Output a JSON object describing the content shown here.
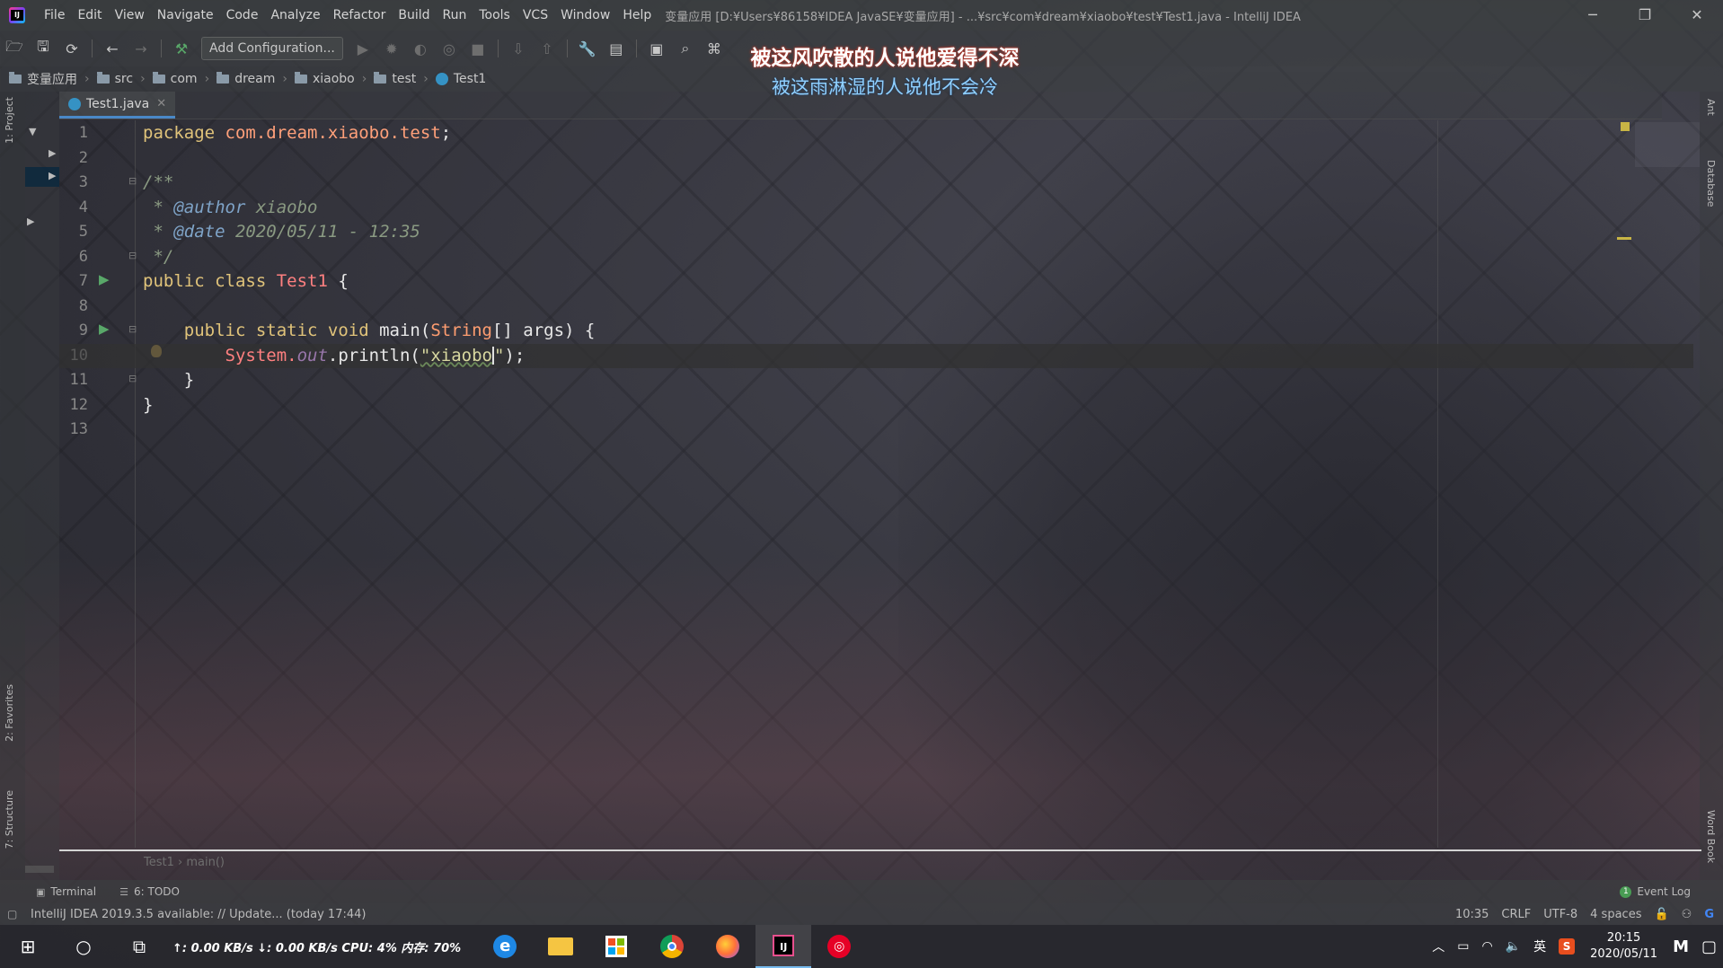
{
  "window": {
    "title": "变量应用 [D:¥Users¥86158¥IDEA JavaSE¥变量应用] - ...¥src¥com¥dream¥xiaobo¥test¥Test1.java - IntelliJ IDEA",
    "controls": {
      "minimize": "─",
      "restore": "❐",
      "close": "✕"
    }
  },
  "menu": [
    "File",
    "Edit",
    "View",
    "Navigate",
    "Code",
    "Analyze",
    "Refactor",
    "Build",
    "Run",
    "Tools",
    "VCS",
    "Window",
    "Help"
  ],
  "toolbar": {
    "add_configuration": "Add Configuration..."
  },
  "breadcrumb": [
    "变量应用",
    "src",
    "com",
    "dream",
    "xiaobo",
    "test",
    "Test1"
  ],
  "lyrics": {
    "line1": "被这风吹散的人说他爱得不深",
    "line2": "被这雨淋湿的人说他不会冷"
  },
  "left_strip": {
    "project": "1: Project",
    "favorites": "2: Favorites",
    "structure": "7: Structure"
  },
  "right_strip": {
    "ant": "Ant",
    "database": "Database",
    "word_book": "Word Book"
  },
  "editor": {
    "tab": "Test1.java",
    "line_numbers": [
      "1",
      "2",
      "3",
      "4",
      "5",
      "6",
      "7",
      "8",
      "9",
      "10",
      "11",
      "12",
      "13"
    ],
    "code": {
      "l1_kw": "package",
      "l1_pkg": "com.dream.xiaobo.test",
      "l1_end": ";",
      "l3": "/**",
      "l4_star": " * ",
      "l4_tag": "@author",
      "l4_val": " xiaobo",
      "l5_star": " * ",
      "l5_tag": "@date",
      "l5_val": " 2020/05/11 - 12:35",
      "l6": " */",
      "l7_kw": "public class ",
      "l7_cls": "Test1",
      "l7_end": " {",
      "l9_indent": "    ",
      "l9_kw": "public static void ",
      "l9_main": "main(",
      "l9_type": "String",
      "l9_rest": "[] args) {",
      "l10_indent": "        ",
      "l10_sys": "System.",
      "l10_out": "out",
      "l10_call": ".println(",
      "l10_str1": "\"xiaobo",
      "l10_str2": "\"",
      "l10_end": ");",
      "l11": "    }",
      "l12": "}"
    },
    "bottom_crumb": "Test1  ›  main()"
  },
  "toolwindows": {
    "terminal": "Terminal",
    "todo": "6: TODO",
    "event_log": "Event Log",
    "event_count": "1"
  },
  "status": {
    "message": "IntelliJ IDEA 2019.3.5 available: // Update... (today 17:44)",
    "position": "10:35",
    "line_sep": "CRLF",
    "encoding": "UTF-8",
    "indent": "4 spaces"
  },
  "taskbar": {
    "net_stats": "↑:  0.00 KB/s  ↓:  0.00 KB/s   CPU:   4%  内存:  70%",
    "ime": "英",
    "time": "20:15",
    "date": "2020/05/11"
  }
}
